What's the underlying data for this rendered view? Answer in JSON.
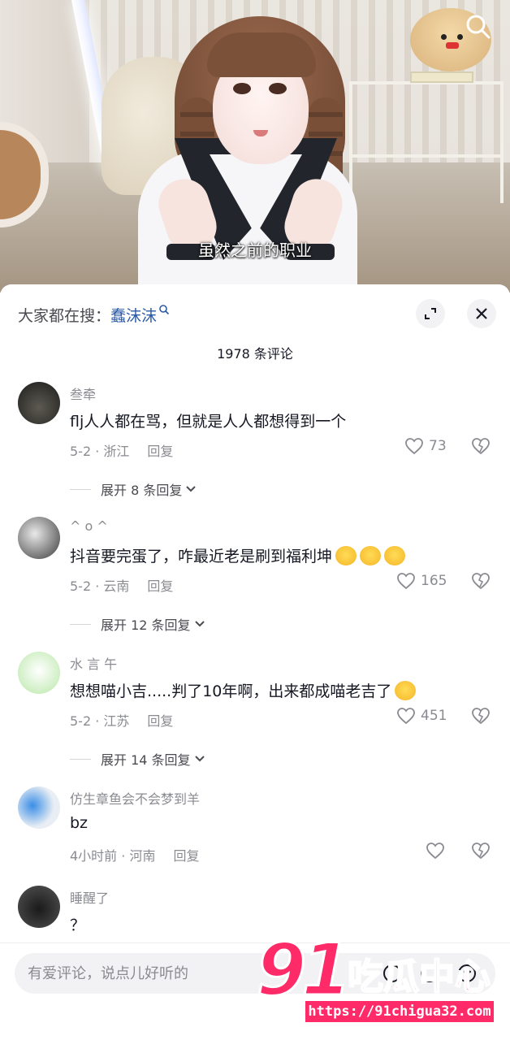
{
  "video": {
    "subtitle": "虽然之前的职业",
    "search_icon": "search-icon"
  },
  "sheet": {
    "trend_prefix": "大家都在搜：",
    "trend_keyword": "蠢沫沫",
    "comment_count": "1978 条评论",
    "expand_icon": "expand-icon",
    "close_icon": "close-icon"
  },
  "comments": [
    {
      "name": "叁牵",
      "text": "flj人人都在骂，但就是人人都想得到一个",
      "date": "5-2",
      "location": "浙江",
      "reply": "回复",
      "likes": "73",
      "expand": "展开 8 条回复"
    },
    {
      "name": "^ o ^",
      "text": "抖音要完蛋了，咋最近老是刷到福利坤",
      "date": "5-2",
      "location": "云南",
      "reply": "回复",
      "likes": "165",
      "expand": "展开 12 条回复"
    },
    {
      "name": "水 言 午",
      "text": "想想喵小吉.....判了10年啊，出来都成喵老吉了",
      "date": "5-2",
      "location": "江苏",
      "reply": "回复",
      "likes": "451",
      "expand": "展开 14 条回复"
    },
    {
      "name": "仿生章鱼会不会梦到羊",
      "text": "bz",
      "date": "4小时前",
      "location": "河南",
      "reply": "回复",
      "likes": "",
      "expand": ""
    },
    {
      "name": "睡醒了",
      "text": "？",
      "date": "",
      "location": "",
      "reply": "",
      "likes": "",
      "expand": ""
    }
  ],
  "input": {
    "placeholder": "有爱评论，说点儿好听的"
  },
  "watermark": {
    "big": "91",
    "cn": "吃瓜中心",
    "url": "https://91chigua32.com"
  },
  "colors": {
    "keyword": "#2b5aa8",
    "muted": "#8a8b91",
    "text": "#161823",
    "watermark": "#ff2a68"
  }
}
